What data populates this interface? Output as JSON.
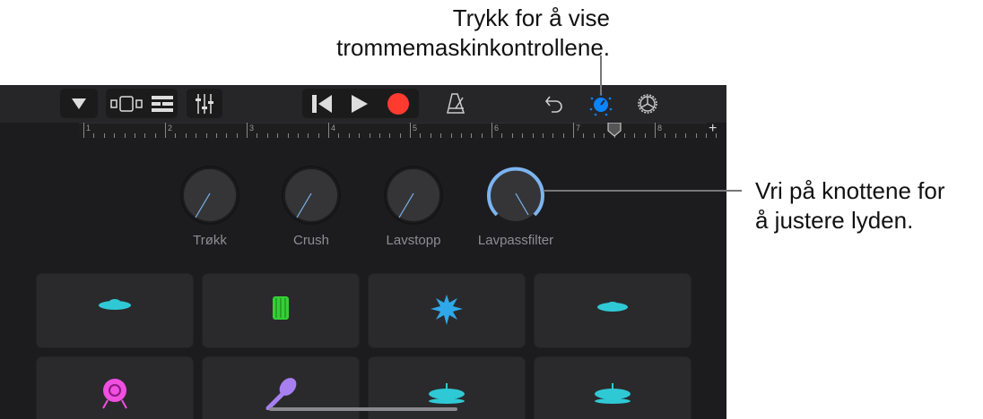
{
  "callouts": {
    "top": [
      "Trykk for å vise",
      "trommemaskinkontrollene."
    ],
    "right": [
      "Vri på knottene for",
      "å justere lyden."
    ]
  },
  "toolbar": {
    "icons": [
      "track-menu",
      "view-toggle",
      "tracks-view",
      "mixer",
      "go-to-start",
      "play",
      "record",
      "metronome",
      "undo",
      "drum-machine-controls",
      "settings"
    ],
    "record_color": "#ff3b30",
    "accent": "#0a84ff"
  },
  "ruler": {
    "bars": [
      "1",
      "2",
      "3",
      "4",
      "5",
      "6",
      "7",
      "8"
    ],
    "add_label": "+"
  },
  "knobs": [
    {
      "label": "Trøkk"
    },
    {
      "label": "Crush"
    },
    {
      "label": "Lavstopp"
    },
    {
      "label": "Lavpassfilter"
    }
  ],
  "pads": [
    "cymbal",
    "snare",
    "clap",
    "hihat",
    "kick",
    "maraca",
    "ride",
    "crash"
  ]
}
